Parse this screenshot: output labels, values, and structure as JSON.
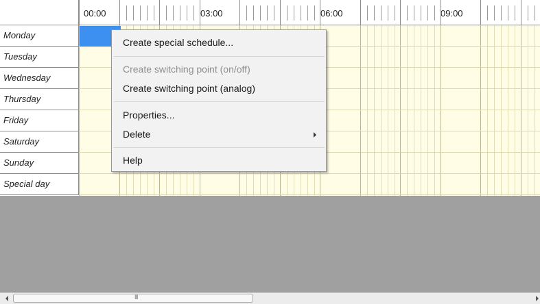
{
  "schedule": {
    "hour_labels": [
      "00:00",
      "03:00",
      "06:00",
      "09:00"
    ],
    "days": [
      "Monday",
      "Tuesday",
      "Wednesday",
      "Thursday",
      "Friday",
      "Saturday",
      "Sunday",
      "Special day"
    ]
  },
  "context_menu": {
    "create_special_schedule": "Create special schedule...",
    "create_switching_onoff": "Create switching point (on/off)",
    "create_switching_analog": "Create switching point (analog)",
    "properties": "Properties...",
    "delete": "Delete",
    "help": "Help"
  },
  "scrollbar": {
    "grip": "III"
  },
  "colors": {
    "selection": "#3d8ff0",
    "grid_background": "#fffde6",
    "empty_area": "#a0a0a0"
  }
}
